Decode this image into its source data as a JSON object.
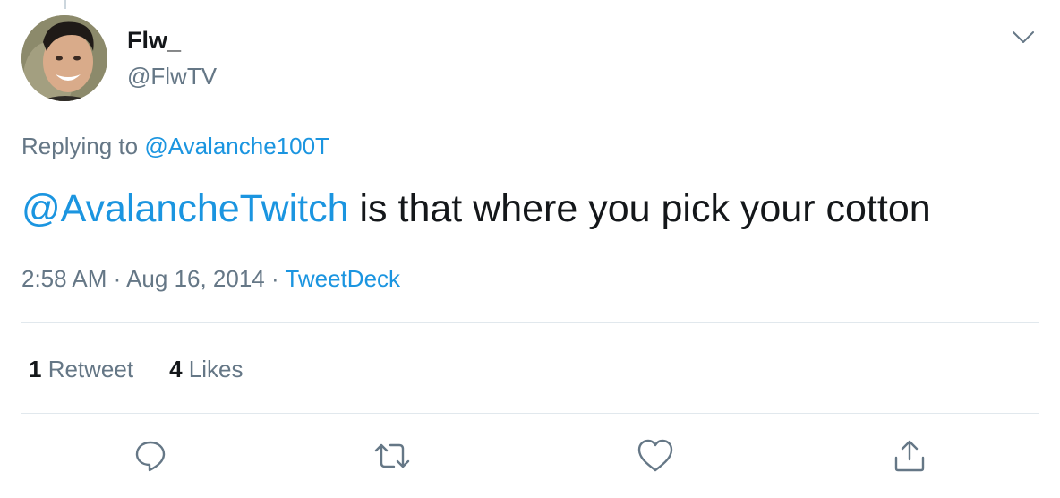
{
  "user": {
    "display_name": "Flw_",
    "handle": "@FlwTV"
  },
  "reply": {
    "prefix": "Replying to ",
    "to": "@Avalanche100T"
  },
  "tweet": {
    "mention": "@AvalancheTwitch",
    "text": " is that where you pick your cotton"
  },
  "meta": {
    "time": "2:58 AM",
    "sep1": " · ",
    "date": "Aug 16, 2014",
    "sep2": " · ",
    "source": "TweetDeck"
  },
  "stats": {
    "retweets_count": "1",
    "retweets_label": " Retweet",
    "likes_count": "4",
    "likes_label": " Likes"
  },
  "icons": {
    "caret": "chevron-down-icon",
    "reply": "reply-icon",
    "retweet": "retweet-icon",
    "like": "heart-icon",
    "share": "share-icon"
  },
  "colors": {
    "link": "#1b95e0",
    "secondary_text": "#657786",
    "primary_text": "#14171a",
    "divider": "#e1e8ed"
  }
}
